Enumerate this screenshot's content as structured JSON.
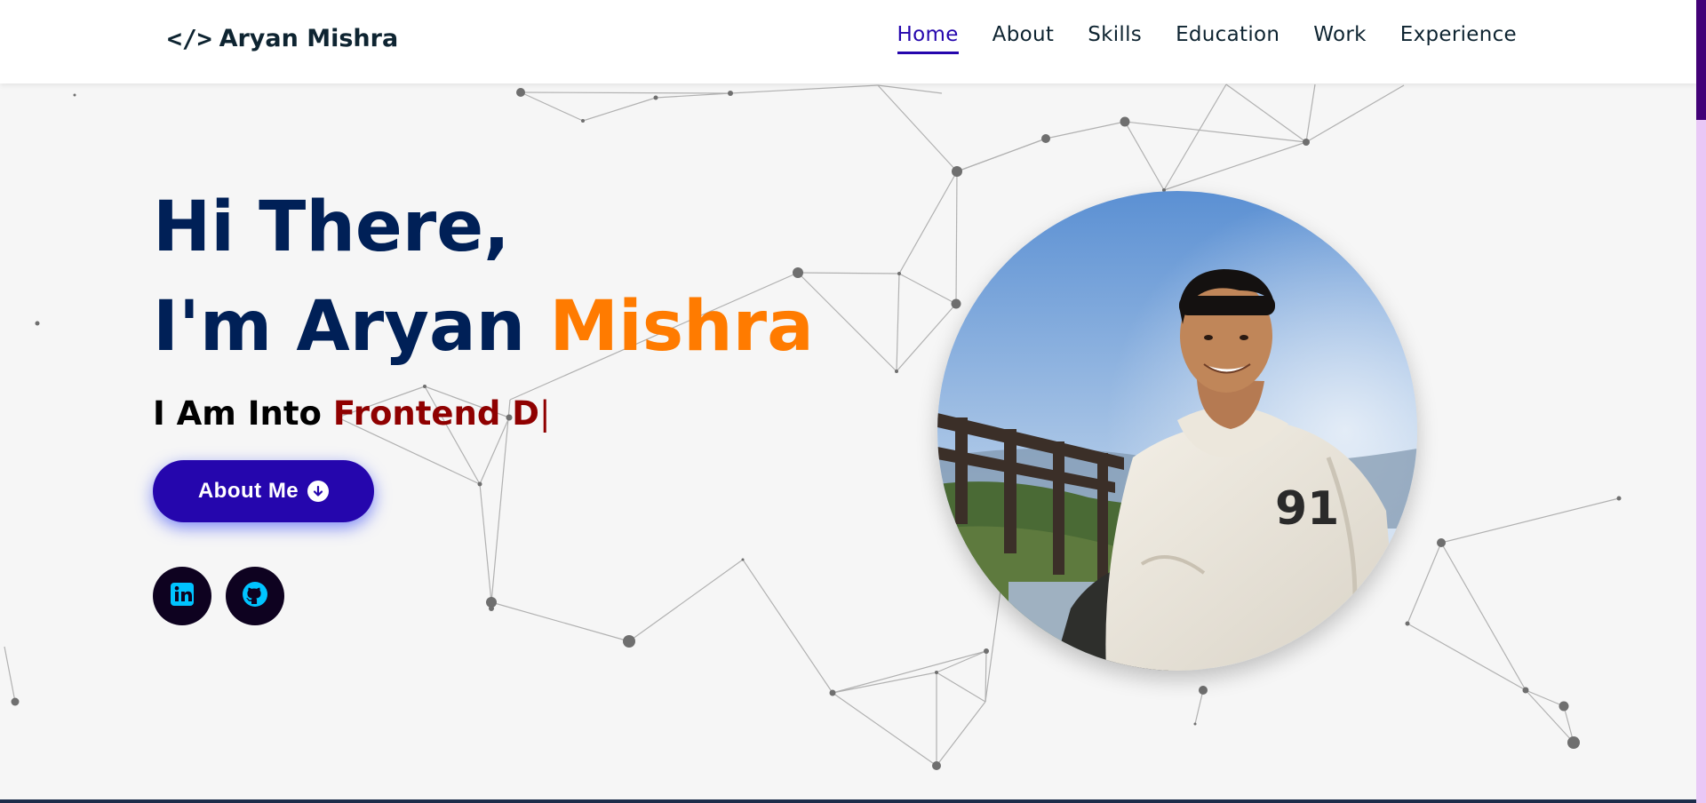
{
  "header": {
    "brand_icon": "</>",
    "brand_name": "Aryan Mishra",
    "nav": [
      {
        "label": "Home",
        "active": true
      },
      {
        "label": "About",
        "active": false
      },
      {
        "label": "Skills",
        "active": false
      },
      {
        "label": "Education",
        "active": false
      },
      {
        "label": "Work",
        "active": false
      },
      {
        "label": "Experience",
        "active": false
      }
    ]
  },
  "hero": {
    "greeting_line1": "Hi There,",
    "greeting_prefix": "I'm Aryan ",
    "greeting_highlight": "Mishra",
    "typing_prefix": "I Am Into ",
    "typing_text": "Frontend D",
    "typing_caret": "|",
    "about_button_label": "About Me",
    "about_button_icon": "arrow-down-circle-icon",
    "socials": [
      {
        "name": "linkedin-icon"
      },
      {
        "name": "github-icon"
      }
    ],
    "photo": {
      "name": "profile-photo",
      "jersey_number": "91"
    }
  },
  "colors": {
    "primary": "#2506ad",
    "heading": "#002057",
    "accent_orange": "#ff7b00",
    "typed_red": "#8f0000",
    "social_bg": "#0e0220",
    "social_icon": "#00c3ff"
  }
}
